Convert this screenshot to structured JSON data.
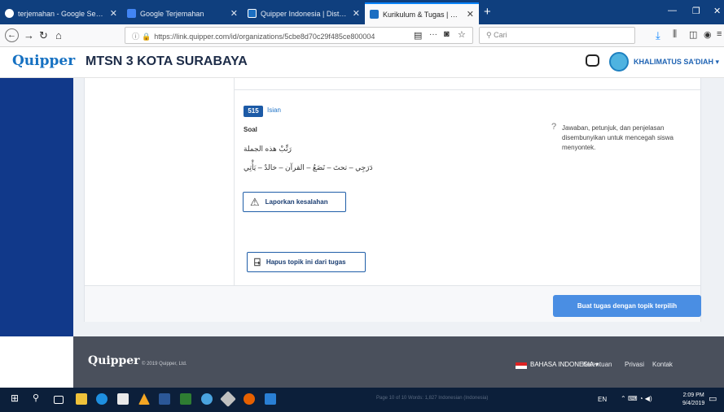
{
  "browser": {
    "tabs": [
      {
        "title": "terjemahan - Google Search",
        "fav_color": "#ffffff"
      },
      {
        "title": "Google Terjemahan",
        "fav_color": "#4285f4"
      },
      {
        "title": "Quipper Indonesia | Distributo",
        "fav_color": "#1c6fc2"
      },
      {
        "title": "Kurikulum & Tugas | Quipper",
        "fav_color": "#1c6fc2"
      }
    ],
    "url": "https://link.quipper.com/id/organizations/5cbe8d70c29f485ce800004",
    "search_placeholder": "Cari"
  },
  "header": {
    "logo": "Quipper",
    "school": "MTSN 3 KOTA SURABAYA",
    "user": "KHALIMATUS SA'DIAH"
  },
  "question": {
    "number": "515",
    "type": "Isian",
    "section_label": "Soal",
    "arabic_prompt": "رَتِّبْ هذه الجملة",
    "arabic_words": "دَرَجِي – تحتَ – تَضَعُ – القرآن – خالدٌ – يَأْتِي",
    "report_label": "Laporkan kesalahan",
    "hint_text": "Jawaban, petunjuk, dan penjelasan disembunyikan untuk mencegah siswa menyontek."
  },
  "actions": {
    "remove_label": "Hapus topik ini dari tugas",
    "assign_label": "Buat tugas dengan topik terpilih"
  },
  "footer": {
    "logo": "Quipper",
    "copyright": "© 2019 Quipper, Ltd.",
    "language": "BAHASA INDONESIA ▾",
    "links": [
      "Ketentuan",
      "Privasi",
      "Kontak"
    ]
  },
  "taskbar": {
    "status_text": "Page 10 of 10    Words: 1,827    Indonesian (Indonesia)",
    "lang": "EN",
    "time": "2:09 PM",
    "date": "9/4/2019"
  }
}
